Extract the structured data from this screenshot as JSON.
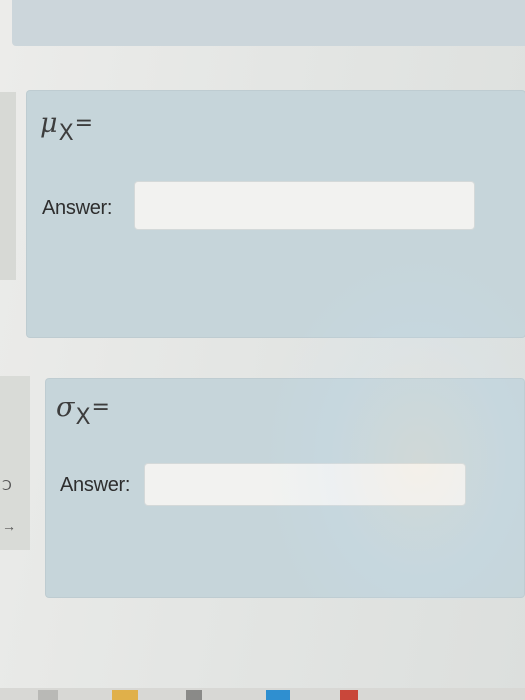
{
  "questions": [
    {
      "symbol": "μ",
      "subscript": "X",
      "equals": "=",
      "answer_label": "Answer:",
      "answer_value": ""
    },
    {
      "symbol": "σ",
      "subscript": "X",
      "equals": "=",
      "answer_label": "Answer:",
      "answer_value": ""
    }
  ],
  "colors": {
    "card": "#c6d5da",
    "input": "#f2f2f0",
    "text": "#2e2e2e"
  },
  "icons": {
    "taskbar": [
      "file-explorer-icon",
      "folder-icon",
      "store-icon",
      "app-icon"
    ]
  }
}
